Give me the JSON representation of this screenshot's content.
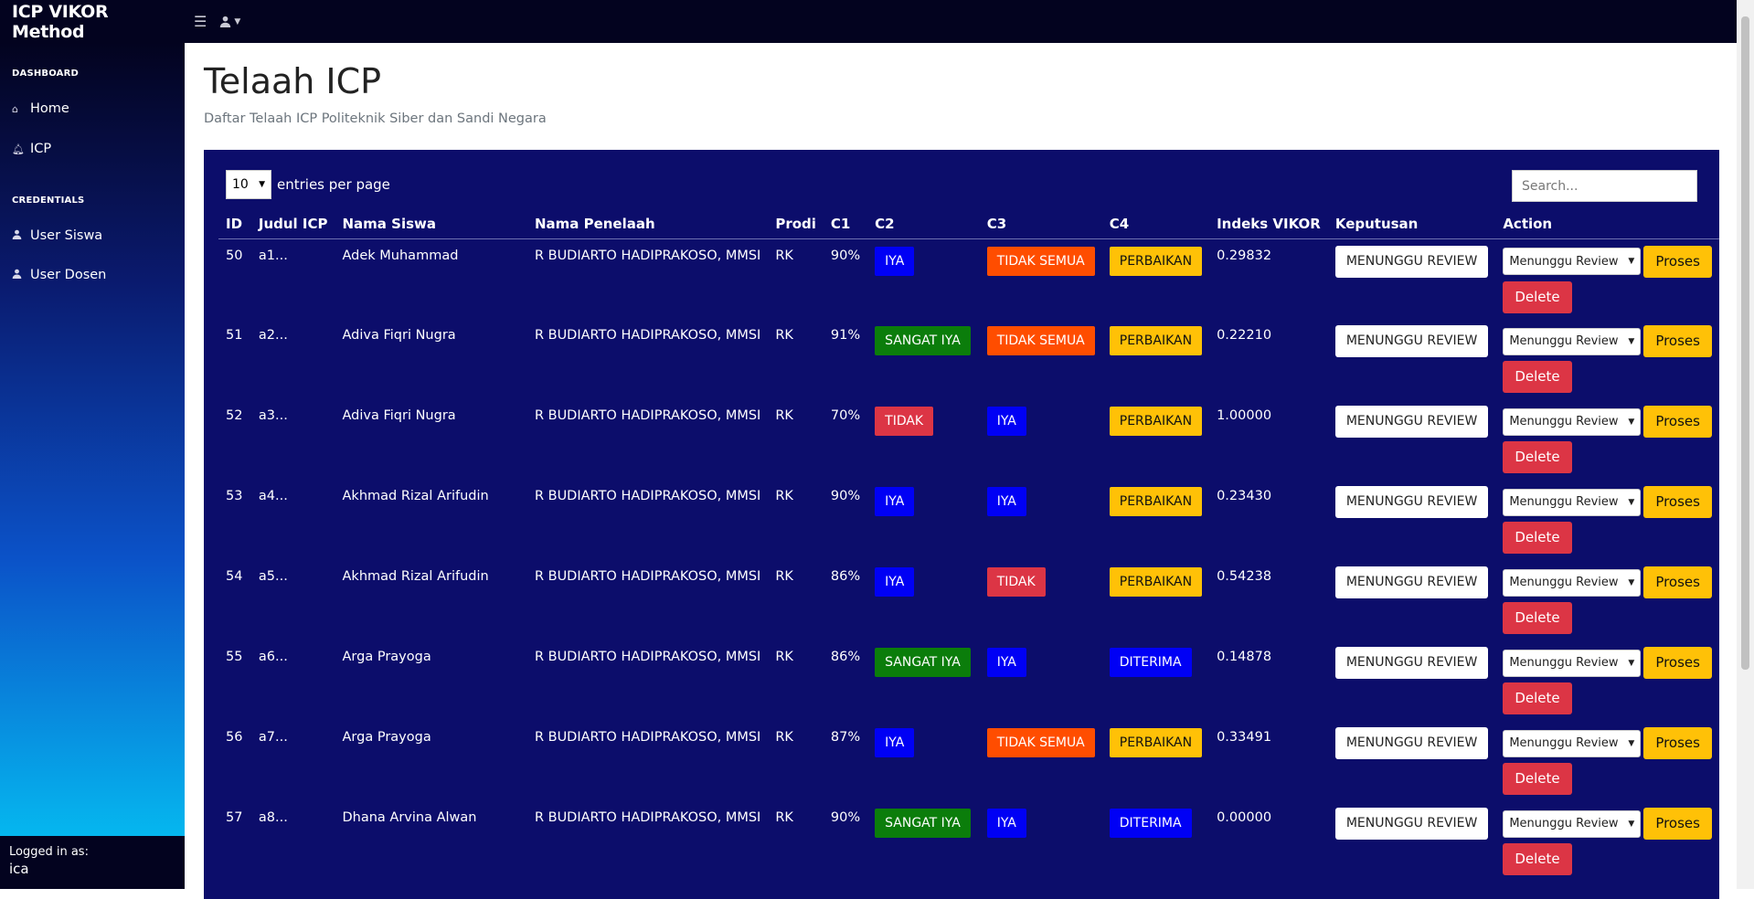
{
  "brand": "ICP VIKOR Method",
  "topnav": {
    "menu_icon": "hamburger-icon",
    "user_icon": "user-icon"
  },
  "sidebar": {
    "sections": [
      {
        "heading": "DASHBOARD",
        "items": [
          {
            "label": "Home",
            "icon": "home-icon"
          },
          {
            "label": "ICP",
            "icon": "bell-icon"
          }
        ]
      },
      {
        "heading": "CREDENTIALS",
        "items": [
          {
            "label": "User Siswa",
            "icon": "user-icon"
          },
          {
            "label": "User Dosen",
            "icon": "user-icon"
          }
        ]
      }
    ],
    "footer": {
      "logged_label": "Logged in as:",
      "username": "ica"
    }
  },
  "page": {
    "title": "Telaah ICP",
    "subtitle": "Daftar Telaah ICP Politeknik Siber dan Sandi Negara"
  },
  "table_controls": {
    "entries_value": "10",
    "entries_label": "entries per page",
    "search_placeholder": "Search..."
  },
  "colors": {
    "card_bg": "#0c0d6b",
    "blue": "#0000f5",
    "green": "#0b7d0b",
    "red": "#dc3545",
    "orange": "#ff4d00",
    "yellow": "#ffc107"
  },
  "table": {
    "headers": [
      "ID",
      "Judul ICP",
      "Nama Siswa",
      "Nama Penelaah",
      "Prodi",
      "C1",
      "C2",
      "C3",
      "C4",
      "Indeks VIKOR",
      "Keputusan",
      "Action"
    ],
    "rows": [
      {
        "id": "50",
        "judul": "a1...",
        "siswa": "Adek Muhammad",
        "penelaah": "R BUDIARTO HADIPRAKOSO, MMSI",
        "prodi": "RK",
        "c1": "90%",
        "c2": "IYA",
        "c2_color": "blue",
        "c3": "TIDAK SEMUA",
        "c3_color": "orange",
        "c4": "PERBAIKAN",
        "c4_color": "yellow",
        "vikor": "0.29832",
        "keputusan": "MENUNGGU REVIEW",
        "status": "Menunggu Review",
        "proses": "Proses",
        "delete": "Delete"
      },
      {
        "id": "51",
        "judul": "a2...",
        "siswa": "Adiva Fiqri Nugra",
        "penelaah": "R BUDIARTO HADIPRAKOSO, MMSI",
        "prodi": "RK",
        "c1": "91%",
        "c2": "SANGAT IYA",
        "c2_color": "green",
        "c3": "TIDAK SEMUA",
        "c3_color": "orange",
        "c4": "PERBAIKAN",
        "c4_color": "yellow",
        "vikor": "0.22210",
        "keputusan": "MENUNGGU REVIEW",
        "status": "Menunggu Review",
        "proses": "Proses",
        "delete": "Delete"
      },
      {
        "id": "52",
        "judul": "a3...",
        "siswa": "Adiva Fiqri Nugra",
        "penelaah": "R BUDIARTO HADIPRAKOSO, MMSI",
        "prodi": "RK",
        "c1": "70%",
        "c2": "TIDAK",
        "c2_color": "red",
        "c3": "IYA",
        "c3_color": "blue",
        "c4": "PERBAIKAN",
        "c4_color": "yellow",
        "vikor": "1.00000",
        "keputusan": "MENUNGGU REVIEW",
        "status": "Menunggu Review",
        "proses": "Proses",
        "delete": "Delete"
      },
      {
        "id": "53",
        "judul": "a4...",
        "siswa": "Akhmad Rizal Arifudin",
        "penelaah": "R BUDIARTO HADIPRAKOSO, MMSI",
        "prodi": "RK",
        "c1": "90%",
        "c2": "IYA",
        "c2_color": "blue",
        "c3": "IYA",
        "c3_color": "blue",
        "c4": "PERBAIKAN",
        "c4_color": "yellow",
        "vikor": "0.23430",
        "keputusan": "MENUNGGU REVIEW",
        "status": "Menunggu Review",
        "proses": "Proses",
        "delete": "Delete"
      },
      {
        "id": "54",
        "judul": "a5...",
        "siswa": "Akhmad Rizal Arifudin",
        "penelaah": "R BUDIARTO HADIPRAKOSO, MMSI",
        "prodi": "RK",
        "c1": "86%",
        "c2": "IYA",
        "c2_color": "blue",
        "c3": "TIDAK",
        "c3_color": "red",
        "c4": "PERBAIKAN",
        "c4_color": "yellow",
        "vikor": "0.54238",
        "keputusan": "MENUNGGU REVIEW",
        "status": "Menunggu Review",
        "proses": "Proses",
        "delete": "Delete"
      },
      {
        "id": "55",
        "judul": "a6...",
        "siswa": "Arga Prayoga",
        "penelaah": "R BUDIARTO HADIPRAKOSO, MMSI",
        "prodi": "RK",
        "c1": "86%",
        "c2": "SANGAT IYA",
        "c2_color": "green",
        "c3": "IYA",
        "c3_color": "blue",
        "c4": "DITERIMA",
        "c4_color": "blue",
        "vikor": "0.14878",
        "keputusan": "MENUNGGU REVIEW",
        "status": "Menunggu Review",
        "proses": "Proses",
        "delete": "Delete"
      },
      {
        "id": "56",
        "judul": "a7...",
        "siswa": "Arga Prayoga",
        "penelaah": "R BUDIARTO HADIPRAKOSO, MMSI",
        "prodi": "RK",
        "c1": "87%",
        "c2": "IYA",
        "c2_color": "blue",
        "c3": "TIDAK SEMUA",
        "c3_color": "orange",
        "c4": "PERBAIKAN",
        "c4_color": "yellow",
        "vikor": "0.33491",
        "keputusan": "MENUNGGU REVIEW",
        "status": "Menunggu Review",
        "proses": "Proses",
        "delete": "Delete"
      },
      {
        "id": "57",
        "judul": "a8...",
        "siswa": "Dhana Arvina Alwan",
        "penelaah": "R BUDIARTO HADIPRAKOSO, MMSI",
        "prodi": "RK",
        "c1": "90%",
        "c2": "SANGAT IYA",
        "c2_color": "green",
        "c3": "IYA",
        "c3_color": "blue",
        "c4": "DITERIMA",
        "c4_color": "blue",
        "vikor": "0.00000",
        "keputusan": "MENUNGGU REVIEW",
        "status": "Menunggu Review",
        "proses": "Proses",
        "delete": "Delete"
      }
    ]
  }
}
